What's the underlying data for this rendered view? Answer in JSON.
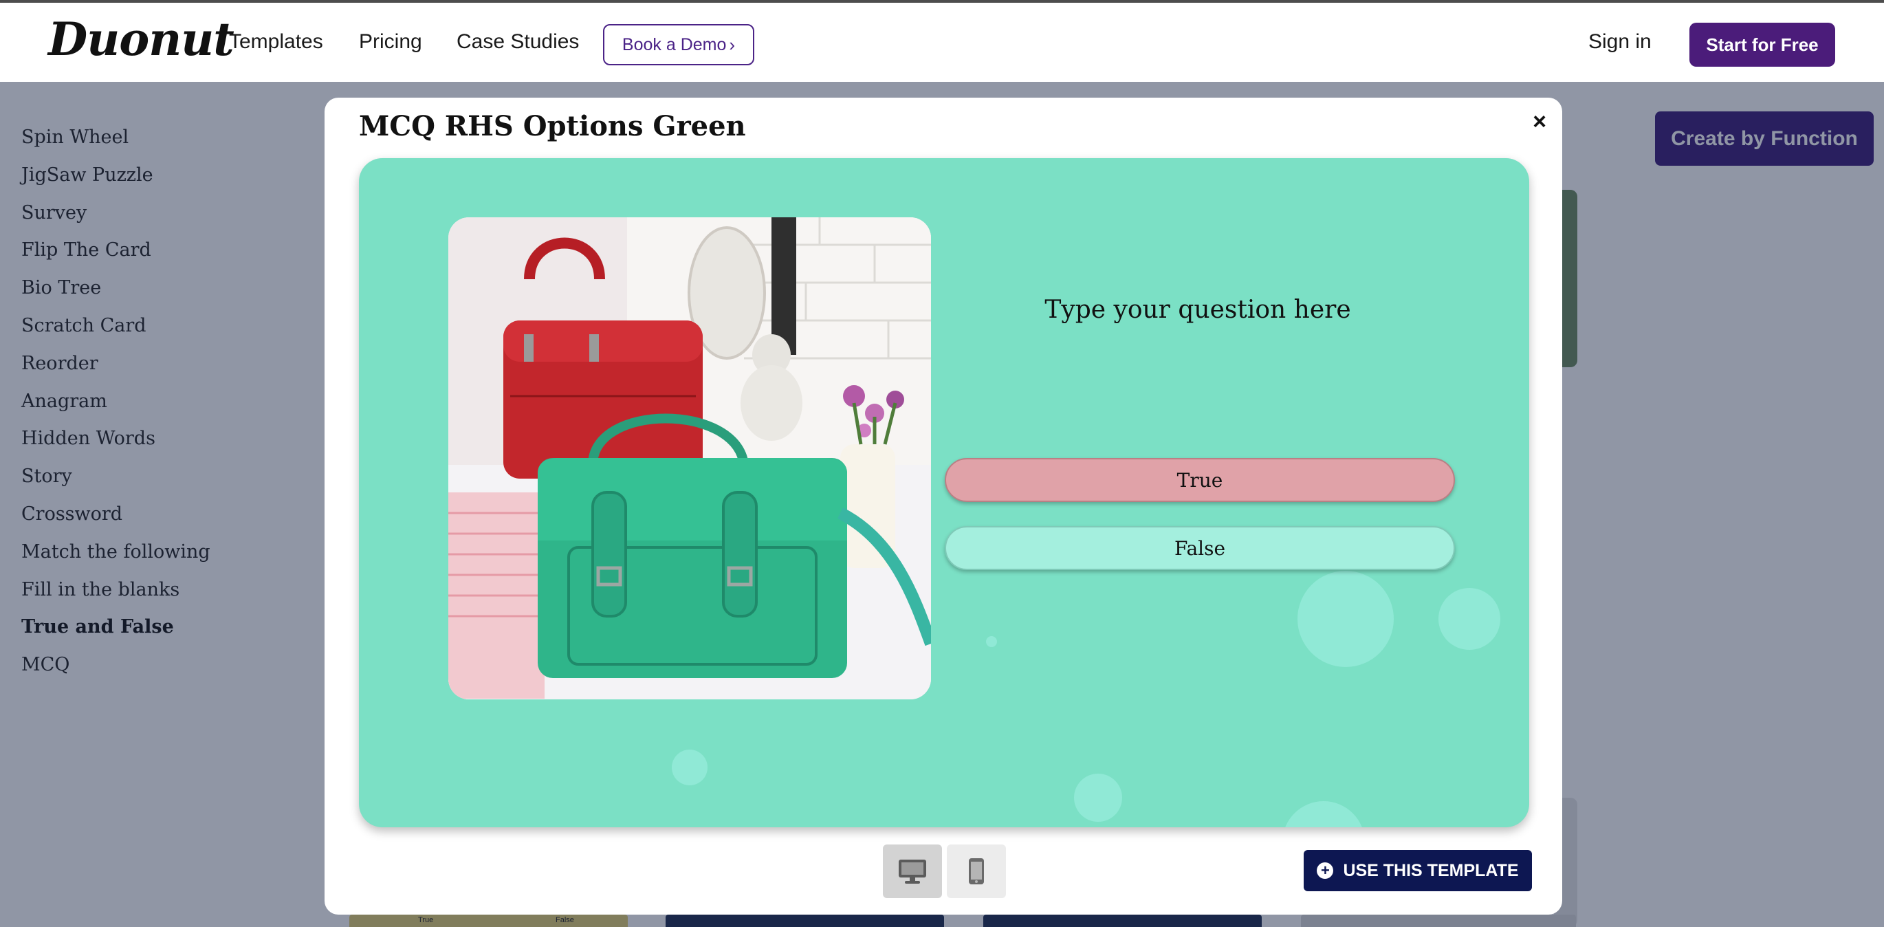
{
  "header": {
    "logo": "Duonut",
    "nav": [
      "Templates",
      "Pricing",
      "Case Studies"
    ],
    "book_demo": "Book a Demo",
    "book_demo_chevron": "›",
    "sign_in": "Sign in",
    "start_free": "Start for Free"
  },
  "sidebar": {
    "items": [
      {
        "label": "Spin Wheel"
      },
      {
        "label": "JigSaw Puzzle"
      },
      {
        "label": "Survey"
      },
      {
        "label": "Flip The Card"
      },
      {
        "label": "Bio Tree"
      },
      {
        "label": "Scratch Card"
      },
      {
        "label": "Reorder"
      },
      {
        "label": "Anagram"
      },
      {
        "label": "Hidden Words"
      },
      {
        "label": "Story"
      },
      {
        "label": "Crossword"
      },
      {
        "label": "Match the following"
      },
      {
        "label": "Fill in the blanks"
      },
      {
        "label": "True and False"
      },
      {
        "label": "MCQ"
      }
    ],
    "active": "True and False"
  },
  "main": {
    "create_by_function": "Create by Function",
    "bg_thumb_labels": [
      "True",
      "False"
    ]
  },
  "modal": {
    "title": "MCQ RHS Options Green",
    "close": "×",
    "question": "Type your question here",
    "options": [
      "True",
      "False"
    ],
    "use_template": "USE THIS TEMPLATE",
    "use_template_icon": "+"
  },
  "colors": {
    "brand_purple": "#4b1c7a",
    "preview_green": "#7be0c5",
    "option_true": "#e0a2a8",
    "option_false": "#a4efde",
    "use_button": "#0d1752"
  },
  "icons": [
    "close-icon",
    "desktop-icon",
    "mobile-icon",
    "plus-circle-icon",
    "chevron-right-icon"
  ]
}
